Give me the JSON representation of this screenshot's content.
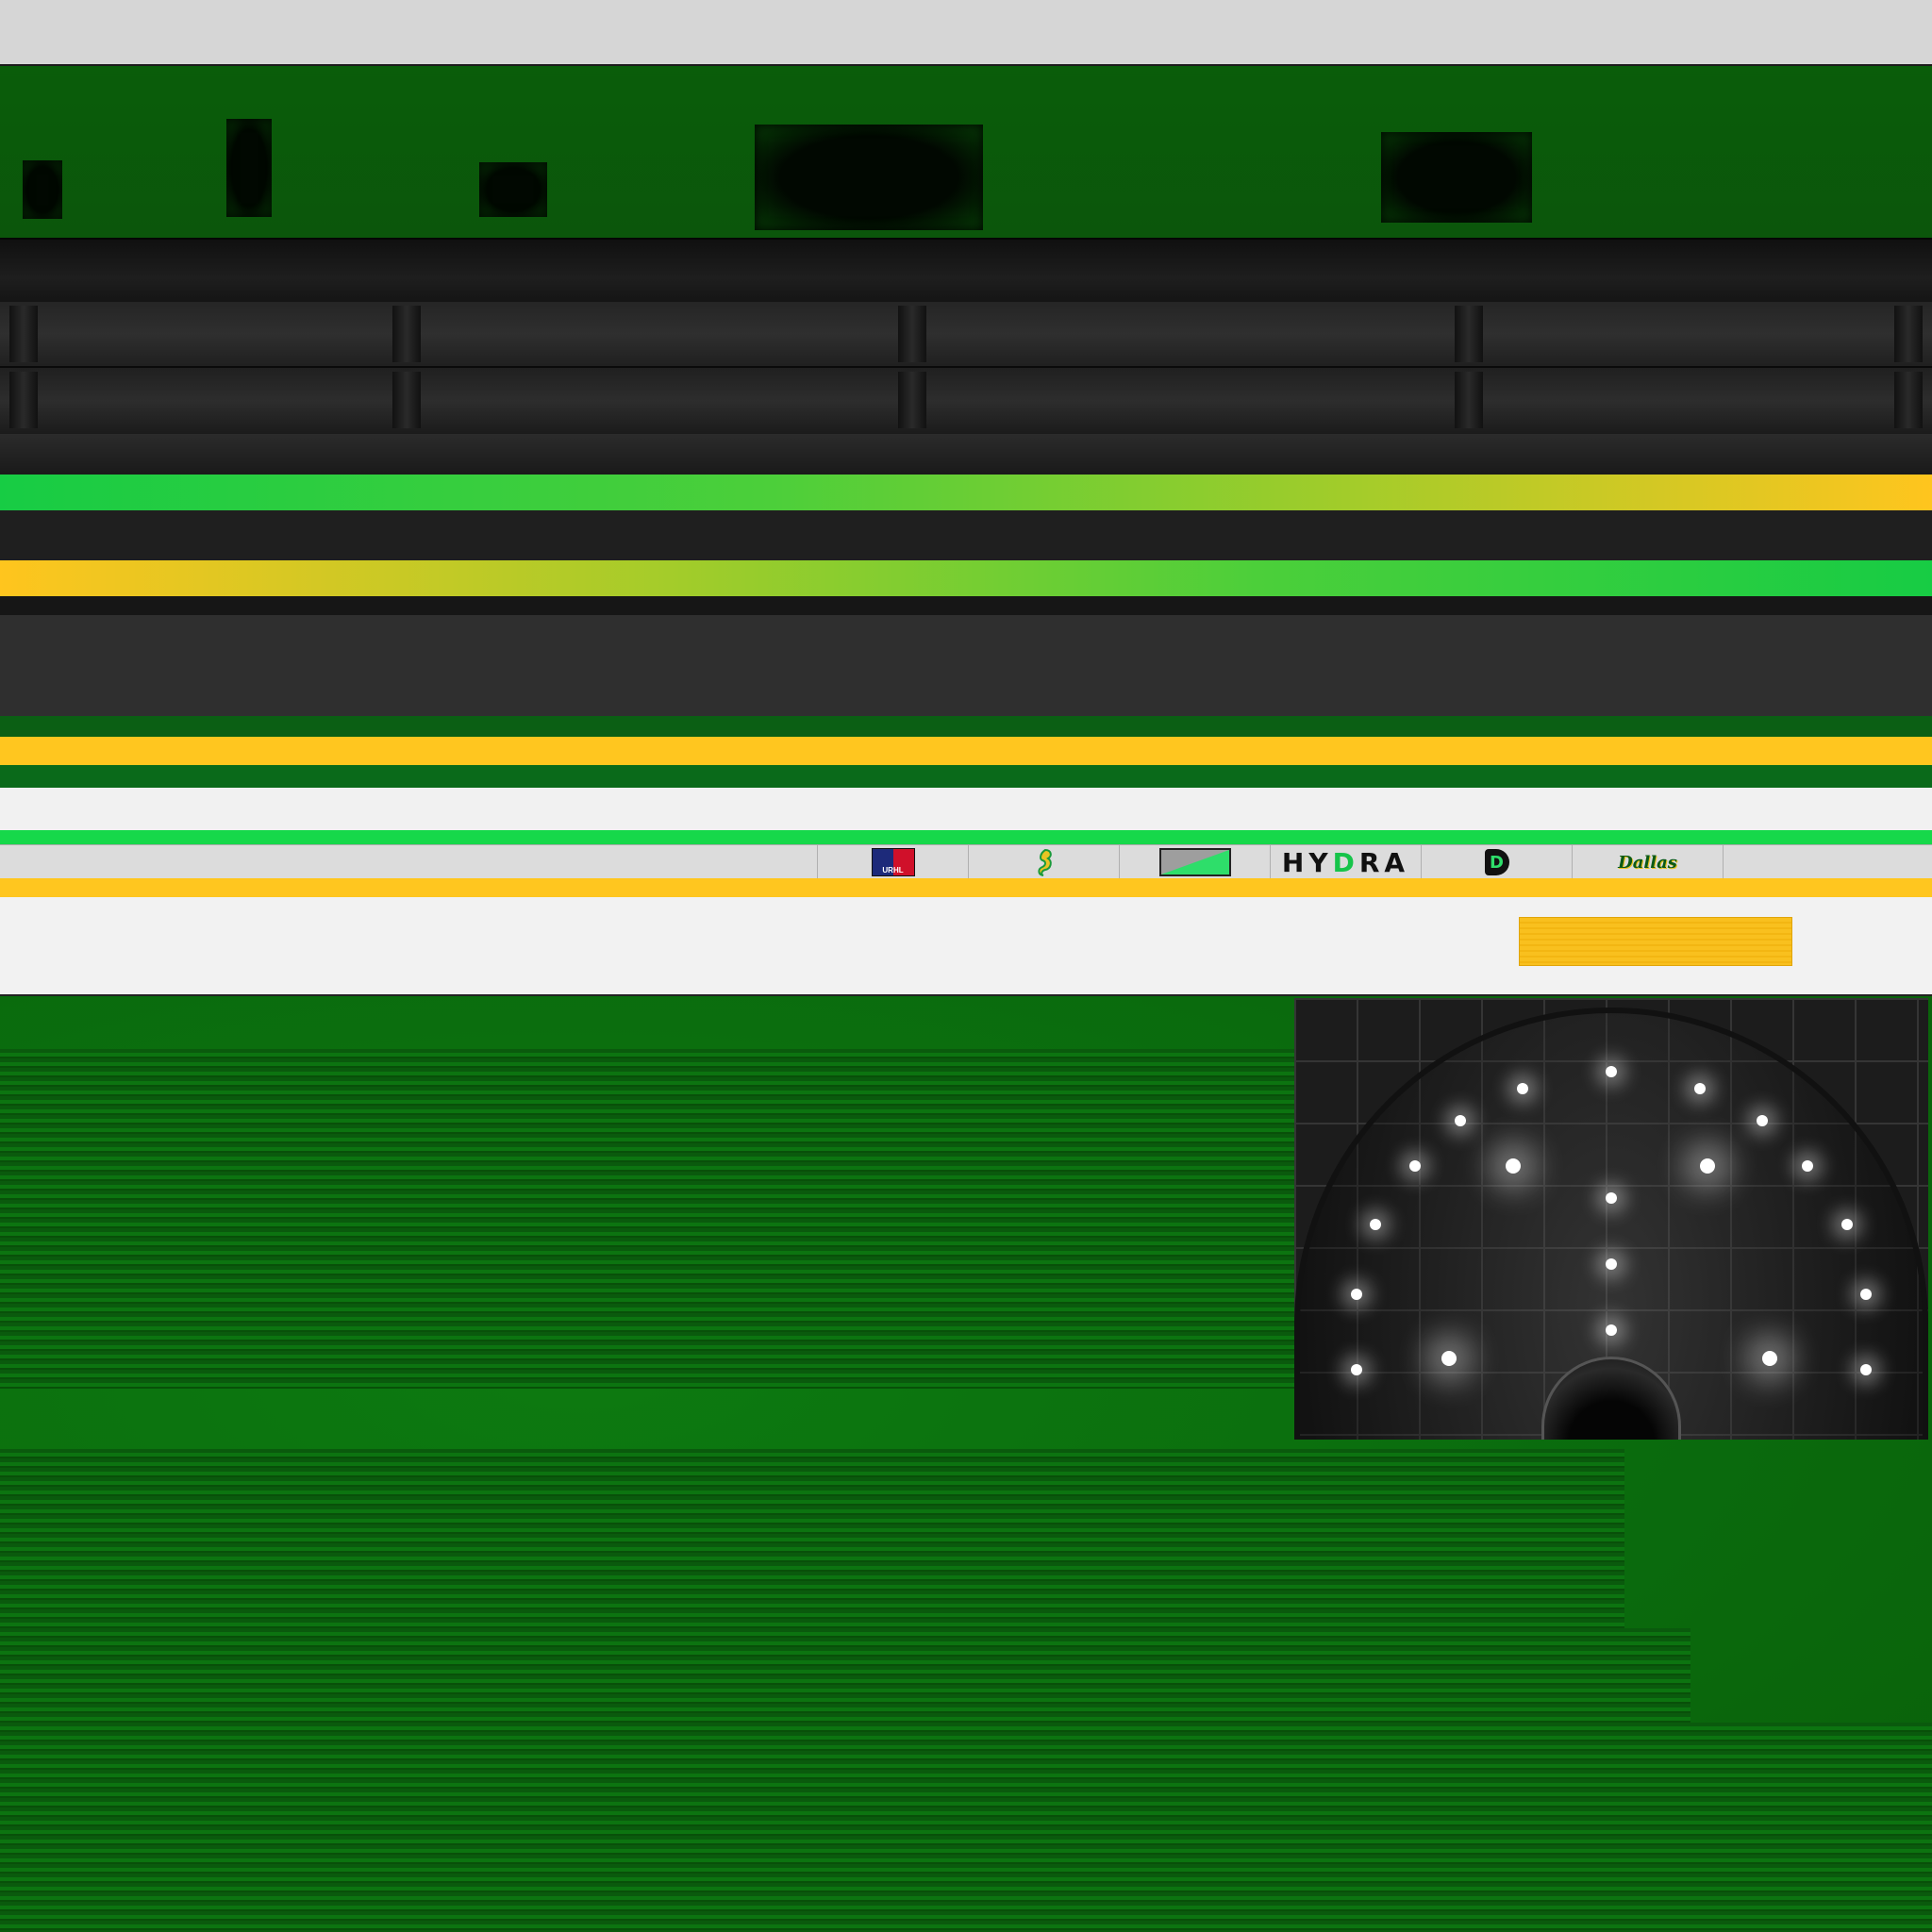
{
  "colors": {
    "field_green": "#0b6a0b",
    "team_green": "#16d84a",
    "team_dark_green": "#0b5f14",
    "team_yellow": "#ffc61f",
    "board_white": "#f1f1f1",
    "rail_dark": "#1f1f1f"
  },
  "sponsors": [
    {
      "name": "URHL",
      "icon": "urhl-league-logo"
    },
    {
      "name": "",
      "icon": "seahorse-logo"
    },
    {
      "name": "",
      "icon": "green-triangle-banner"
    },
    {
      "name": "HYDRA",
      "icon": "hydra-wordmark"
    },
    {
      "name": "D",
      "icon": "team-d-monogram"
    },
    {
      "name": "Dallas",
      "icon": "dallas-script-logo"
    }
  ],
  "hydra": {
    "pre": "HY",
    "accent": "D",
    "post": "RA"
  },
  "urhl_label": "URHL",
  "dallas_label": "Dallas",
  "d_label": "D"
}
